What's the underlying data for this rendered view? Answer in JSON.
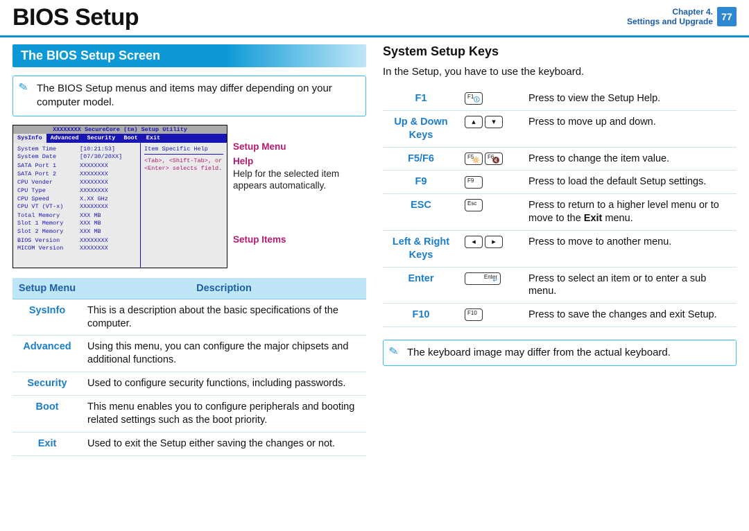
{
  "title": "BIOS Setup",
  "chapter": {
    "label": "Chapter 4.",
    "subtitle": "Settings and Upgrade",
    "page": "77"
  },
  "left": {
    "heading": "The BIOS Setup Screen",
    "note": "The BIOS Setup menus and items may differ depending on your computer model.",
    "bios": {
      "utility_title": "XXXXXXXX SecureCore (tm) Setup Utility",
      "menus": [
        "SysInfo",
        "Advanced",
        "Security",
        "Boot",
        "Exit"
      ],
      "rows": [
        {
          "lab": "System Time",
          "val": "[10:21:53]"
        },
        {
          "lab": "System Date",
          "val": "[07/30/20XX]"
        },
        {
          "lab": "",
          "val": ""
        },
        {
          "lab": "SATA Port 1",
          "val": "XXXXXXXX"
        },
        {
          "lab": "SATA Port 2",
          "val": "XXXXXXXX"
        },
        {
          "lab": "",
          "val": ""
        },
        {
          "lab": "CPU Vender",
          "val": "XXXXXXXX"
        },
        {
          "lab": "CPU Type",
          "val": "XXXXXXXX"
        },
        {
          "lab": "CPU Speed",
          "val": "X.XX GHz"
        },
        {
          "lab": "CPU VT (VT-x)",
          "val": "XXXXXXXX"
        },
        {
          "lab": "",
          "val": ""
        },
        {
          "lab": "Total Memory",
          "val": "XXX MB"
        },
        {
          "lab": " Slot 1 Memory",
          "val": "XXX MB"
        },
        {
          "lab": " Slot 2 Memory",
          "val": "XXX MB"
        },
        {
          "lab": "",
          "val": ""
        },
        {
          "lab": "BIOS Version",
          "val": "XXXXXXXX"
        },
        {
          "lab": "MICOM Version",
          "val": "XXXXXXXX"
        }
      ],
      "help_header": "Item Specific Help",
      "help_body": "<Tab>, <Shift-Tab>, or <Enter> selects field."
    },
    "callouts": {
      "menu": "Setup Menu",
      "help_title": "Help",
      "help_text": "Help for the selected item appears automatically.",
      "items": "Setup Items"
    },
    "table": {
      "head": [
        "Setup Menu",
        "Description"
      ],
      "rows": [
        {
          "name": "SysInfo",
          "desc": "This is a description about the basic specifications of the computer."
        },
        {
          "name": "Advanced",
          "desc": "Using this menu, you can configure the major chipsets and additional functions."
        },
        {
          "name": "Security",
          "desc": "Used to configure security functions, including passwords."
        },
        {
          "name": "Boot",
          "desc": "This menu enables you to configure peripherals and booting related settings such as the boot priority."
        },
        {
          "name": "Exit",
          "desc": "Used to exit the Setup either saving the changes or not."
        }
      ]
    }
  },
  "right": {
    "heading": "System Setup Keys",
    "intro": "In the Setup, you have to use the keyboard.",
    "rows": [
      {
        "name": "F1",
        "keys": [
          {
            "t": "F1",
            "sub": "🛈"
          }
        ],
        "desc": "Press to view the Setup Help."
      },
      {
        "name": "Up & Down Keys",
        "keys": [
          {
            "sym": "▴"
          },
          {
            "sym": "▾"
          }
        ],
        "desc": "Press to move up and down."
      },
      {
        "name": "F5/F6",
        "keys": [
          {
            "t": "F5",
            "sub": "🔆"
          },
          {
            "t": "F6",
            "sub": "🔇"
          }
        ],
        "desc": "Press to change the item value."
      },
      {
        "name": "F9",
        "keys": [
          {
            "t": "F9"
          }
        ],
        "desc": "Press to load the default Setup settings."
      },
      {
        "name": "ESC",
        "keys": [
          {
            "t": "Esc"
          }
        ],
        "desc": "Press to return to a higher level menu or to move to the <b>Exit</b> menu."
      },
      {
        "name": "Left & Right Keys",
        "keys": [
          {
            "sym": "◂"
          },
          {
            "sym": "▸"
          }
        ],
        "desc": "Press to move another menu."
      },
      {
        "name": "Enter",
        "keys": [
          {
            "t": "Enter",
            "wide": true,
            "sub": "↵"
          }
        ],
        "desc": "Press to select an item or to enter a sub menu."
      },
      {
        "name": "F10",
        "keys": [
          {
            "t": "F10"
          }
        ],
        "desc": "Press to save the changes and exit Setup."
      }
    ],
    "rows_fix": {
      "5": "Press to move to another menu."
    },
    "note": "The keyboard image may differ from the actual keyboard."
  }
}
